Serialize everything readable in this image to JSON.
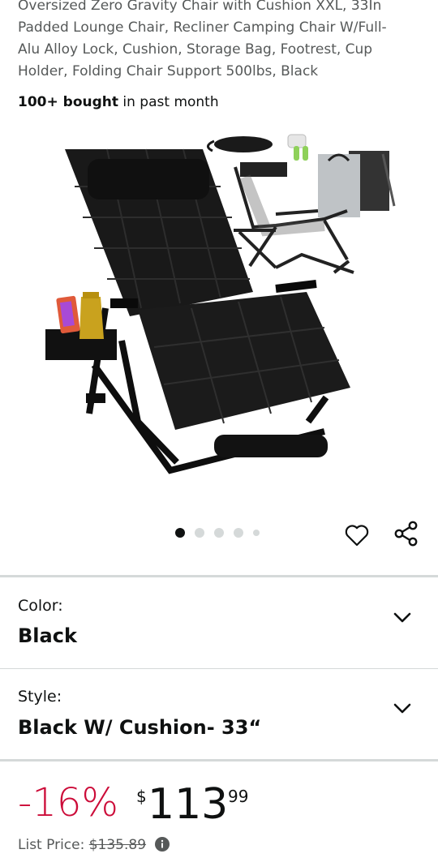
{
  "product": {
    "title_lines": [
      "Oversized Zero Gravity Chair with Cushion XXL, 33In",
      "Padded Lounge Chair, Recliner Camping Chair W/Full-",
      "Alu Alloy Lock, Cushion, Storage Bag, Footrest, Cup",
      "Holder, Folding Chair Support 500lbs, Black"
    ],
    "bought_bold": "100+ bought",
    "bought_rest": " in past month"
  },
  "gallery": {
    "image_count": 5,
    "active_index": 0
  },
  "variations": {
    "color_label": "Color:",
    "color_value": "Black",
    "style_label": "Style:",
    "style_value": "Black W/ Cushion- 33“"
  },
  "price": {
    "discount": "-16%",
    "currency": "$",
    "whole": "113",
    "fraction": "99",
    "list_label": "List Price: ",
    "list_value": "$135.89"
  },
  "colors": {
    "discount": "#CC0C39",
    "text": "#0F1111",
    "secondary_text": "#565959",
    "divider": "#d5d9d9"
  },
  "icons": [
    "heart-icon",
    "share-icon",
    "chevron-down-icon",
    "info-icon"
  ]
}
